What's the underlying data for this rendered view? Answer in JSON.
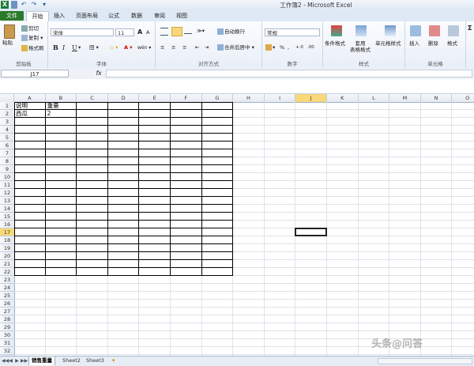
{
  "window": {
    "title": "工作簿2 - Microsoft Excel"
  },
  "quick_access": {
    "undo": "↶",
    "redo": "↷",
    "customize": "▾"
  },
  "tabs": [
    {
      "label": "文件"
    },
    {
      "label": "开始"
    },
    {
      "label": "插入"
    },
    {
      "label": "页面布局"
    },
    {
      "label": "公式"
    },
    {
      "label": "数据"
    },
    {
      "label": "审阅"
    },
    {
      "label": "视图"
    }
  ],
  "ribbon": {
    "clipboard": {
      "paste": "粘贴",
      "cut": "剪切",
      "copy": "复制 ▾",
      "painter": "格式刷",
      "group": "剪贴板"
    },
    "font": {
      "name": "宋体",
      "size": "11",
      "grow": "A",
      "shrink": "A",
      "bold": "B",
      "italic": "I",
      "underline": "U",
      "underline_arrow": "▾",
      "border": "田 ▾",
      "fill": "◇ ▾",
      "color": "A ▾",
      "wen": "wén ▾",
      "group": "字体"
    },
    "alignment": {
      "wrap": "自动换行",
      "merge": "合并后居中 ▾",
      "group": "对齐方式"
    },
    "number": {
      "format": "常规",
      "percent": "%",
      "comma": ",",
      "currency": "▾",
      "inc": "+.0",
      "dec": ".00",
      "group": "数字"
    },
    "styles": {
      "cond": "条件格式",
      "table": "套用\n表格格式",
      "cell": "单元格样式",
      "group": "样式"
    },
    "cells": {
      "insert": "插入",
      "delete": "删除",
      "format": "格式",
      "group": "单元格"
    },
    "editing": {
      "sigma": "Σ"
    }
  },
  "formula_bar": {
    "name_box": "J17",
    "fx": "fx",
    "value": ""
  },
  "columns": [
    "A",
    "B",
    "C",
    "D",
    "E",
    "F",
    "G",
    "H",
    "I",
    "J",
    "K",
    "L",
    "M",
    "N",
    "O"
  ],
  "rows": [
    "1",
    "2",
    "3",
    "4",
    "5",
    "6",
    "7",
    "8",
    "9",
    "10",
    "11",
    "12",
    "13",
    "14",
    "15",
    "16",
    "17",
    "18",
    "19",
    "20",
    "21",
    "22",
    "23",
    "24",
    "25",
    "26",
    "27",
    "28",
    "29",
    "30",
    "31",
    "32"
  ],
  "selected": {
    "column": "J",
    "row": "17"
  },
  "cells": {
    "A1": "说明",
    "B1": "重量",
    "A2": "西瓜",
    "B2": "2"
  },
  "sheets": [
    {
      "label": "销售重量"
    },
    {
      "label": "Sheet2"
    },
    {
      "label": "Sheet3"
    }
  ],
  "nav": {
    "first": "◀◀",
    "prev": "◀",
    "next": "▶",
    "last": "▶▶"
  },
  "watermark": "头条@问答"
}
